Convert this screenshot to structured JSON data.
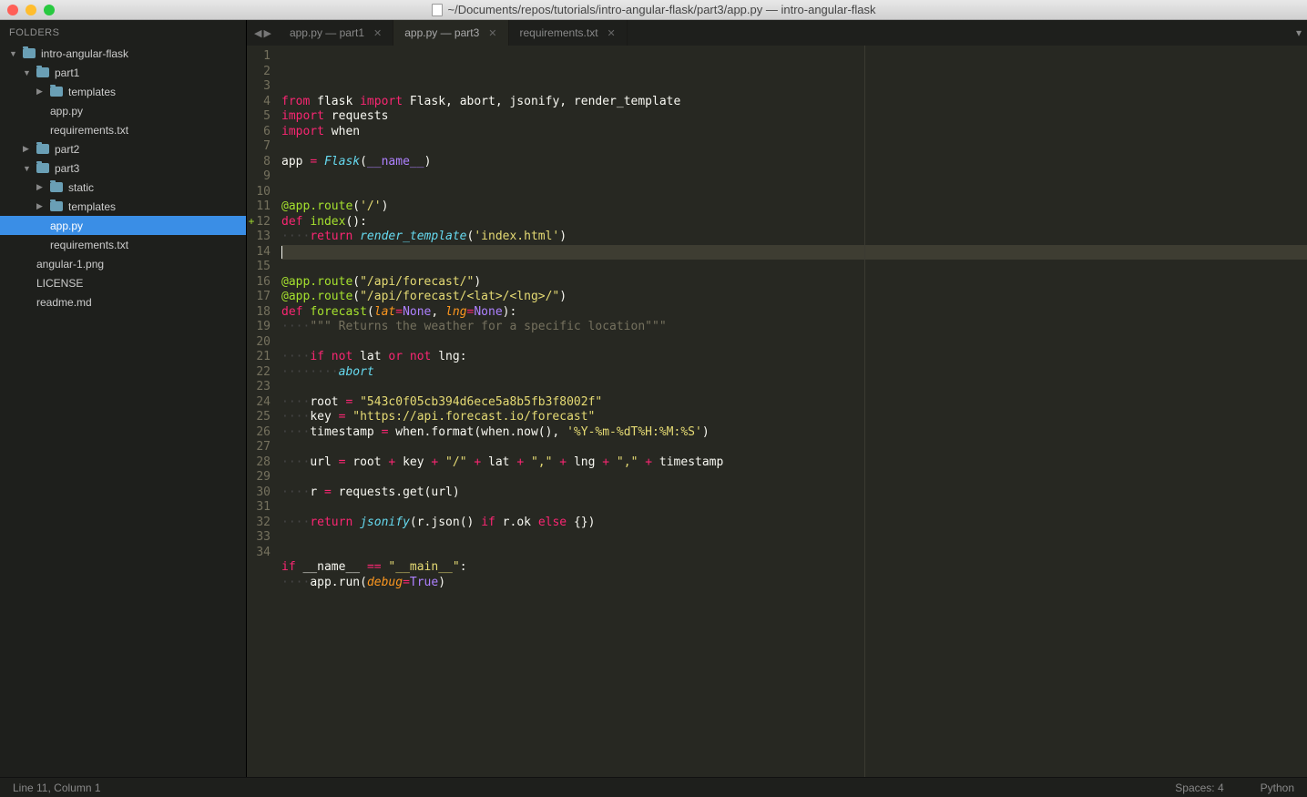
{
  "window": {
    "title": "~/Documents/repos/tutorials/intro-angular-flask/part3/app.py — intro-angular-flask"
  },
  "sidebar": {
    "header": "FOLDERS",
    "tree": [
      {
        "label": "intro-angular-flask",
        "type": "folder",
        "depth": 0,
        "expanded": true
      },
      {
        "label": "part1",
        "type": "folder",
        "depth": 1,
        "expanded": true
      },
      {
        "label": "templates",
        "type": "folder",
        "depth": 2,
        "expanded": false
      },
      {
        "label": "app.py",
        "type": "file",
        "depth": 2
      },
      {
        "label": "requirements.txt",
        "type": "file",
        "depth": 2
      },
      {
        "label": "part2",
        "type": "folder",
        "depth": 1,
        "expanded": false
      },
      {
        "label": "part3",
        "type": "folder",
        "depth": 1,
        "expanded": true
      },
      {
        "label": "static",
        "type": "folder",
        "depth": 2,
        "expanded": false
      },
      {
        "label": "templates",
        "type": "folder",
        "depth": 2,
        "expanded": false
      },
      {
        "label": "app.py",
        "type": "file",
        "depth": 2,
        "selected": true
      },
      {
        "label": "requirements.txt",
        "type": "file",
        "depth": 2
      },
      {
        "label": "angular-1.png",
        "type": "file",
        "depth": 1
      },
      {
        "label": "LICENSE",
        "type": "file",
        "depth": 1
      },
      {
        "label": "readme.md",
        "type": "file",
        "depth": 1
      }
    ]
  },
  "tabs": [
    {
      "label": "app.py — part1",
      "active": false
    },
    {
      "label": "app.py — part3",
      "active": true
    },
    {
      "label": "requirements.txt",
      "active": false
    }
  ],
  "editor": {
    "ruler_col": 80,
    "gutter_plus_line": 12,
    "current_line_index": 10,
    "lines": [
      [
        {
          "t": "from",
          "c": "kw"
        },
        {
          "t": " "
        },
        {
          "t": "flask",
          "c": ""
        },
        {
          "t": " "
        },
        {
          "t": "import",
          "c": "kw"
        },
        {
          "t": " "
        },
        {
          "t": "Flask, abort, jsonify, render_template",
          "c": ""
        }
      ],
      [
        {
          "t": "import",
          "c": "kw"
        },
        {
          "t": " "
        },
        {
          "t": "requests",
          "c": ""
        }
      ],
      [
        {
          "t": "import",
          "c": "kw"
        },
        {
          "t": " "
        },
        {
          "t": "when",
          "c": ""
        }
      ],
      [],
      [
        {
          "t": "app ",
          "c": ""
        },
        {
          "t": "=",
          "c": "op"
        },
        {
          "t": " ",
          "c": ""
        },
        {
          "t": "Flask",
          "c": "cls"
        },
        {
          "t": "(",
          "c": ""
        },
        {
          "t": "__name__",
          "c": "const"
        },
        {
          "t": ")",
          "c": ""
        }
      ],
      [],
      [],
      [
        {
          "t": "@app.route",
          "c": "decorator"
        },
        {
          "t": "(",
          "c": ""
        },
        {
          "t": "'/'",
          "c": "str"
        },
        {
          "t": ")",
          "c": ""
        }
      ],
      [
        {
          "t": "def",
          "c": "kw"
        },
        {
          "t": " "
        },
        {
          "t": "index",
          "c": "fn"
        },
        {
          "t": "():",
          "c": ""
        }
      ],
      [
        {
          "t": "····",
          "c": "dots"
        },
        {
          "t": "return",
          "c": "kw"
        },
        {
          "t": " ",
          "c": ""
        },
        {
          "t": "render_template",
          "c": "cls"
        },
        {
          "t": "(",
          "c": ""
        },
        {
          "t": "'index.html'",
          "c": "str"
        },
        {
          "t": ")",
          "c": ""
        }
      ],
      [
        {
          "t": "",
          "c": "",
          "cursor": true
        }
      ],
      [],
      [
        {
          "t": "@app.route",
          "c": "decorator"
        },
        {
          "t": "(",
          "c": ""
        },
        {
          "t": "\"/api/forecast/\"",
          "c": "str"
        },
        {
          "t": ")",
          "c": ""
        }
      ],
      [
        {
          "t": "@app.route",
          "c": "decorator"
        },
        {
          "t": "(",
          "c": ""
        },
        {
          "t": "\"/api/forecast/<lat>/<lng>/\"",
          "c": "str"
        },
        {
          "t": ")",
          "c": ""
        }
      ],
      [
        {
          "t": "def",
          "c": "kw"
        },
        {
          "t": " "
        },
        {
          "t": "forecast",
          "c": "fn"
        },
        {
          "t": "(",
          "c": ""
        },
        {
          "t": "lat",
          "c": "param"
        },
        {
          "t": "=",
          "c": "op"
        },
        {
          "t": "None",
          "c": "const"
        },
        {
          "t": ", ",
          "c": ""
        },
        {
          "t": "lng",
          "c": "param"
        },
        {
          "t": "=",
          "c": "op"
        },
        {
          "t": "None",
          "c": "const"
        },
        {
          "t": "):",
          "c": ""
        }
      ],
      [
        {
          "t": "····",
          "c": "dots"
        },
        {
          "t": "\"\"\" Returns the weather for a specific location\"\"\"",
          "c": "comment"
        }
      ],
      [],
      [
        {
          "t": "····",
          "c": "dots"
        },
        {
          "t": "if",
          "c": "kw"
        },
        {
          "t": " "
        },
        {
          "t": "not",
          "c": "kw"
        },
        {
          "t": " lat "
        },
        {
          "t": "or",
          "c": "kw"
        },
        {
          "t": " "
        },
        {
          "t": "not",
          "c": "kw"
        },
        {
          "t": " lng:",
          "c": ""
        }
      ],
      [
        {
          "t": "········",
          "c": "dots"
        },
        {
          "t": "abort",
          "c": "cls"
        }
      ],
      [],
      [
        {
          "t": "····",
          "c": "dots"
        },
        {
          "t": "root ",
          "c": ""
        },
        {
          "t": "=",
          "c": "op"
        },
        {
          "t": " ",
          "c": ""
        },
        {
          "t": "\"543c0f05cb394d6ece5a8b5fb3f8002f\"",
          "c": "str"
        }
      ],
      [
        {
          "t": "····",
          "c": "dots"
        },
        {
          "t": "key ",
          "c": ""
        },
        {
          "t": "=",
          "c": "op"
        },
        {
          "t": " ",
          "c": ""
        },
        {
          "t": "\"https://api.forecast.io/forecast\"",
          "c": "str"
        }
      ],
      [
        {
          "t": "····",
          "c": "dots"
        },
        {
          "t": "timestamp ",
          "c": ""
        },
        {
          "t": "=",
          "c": "op"
        },
        {
          "t": " when.format(when.now(), ",
          "c": ""
        },
        {
          "t": "'%Y-%m-%dT%H:%M:%S'",
          "c": "str"
        },
        {
          "t": ")",
          "c": ""
        }
      ],
      [],
      [
        {
          "t": "····",
          "c": "dots"
        },
        {
          "t": "url ",
          "c": ""
        },
        {
          "t": "=",
          "c": "op"
        },
        {
          "t": " root ",
          "c": ""
        },
        {
          "t": "+",
          "c": "op"
        },
        {
          "t": " key ",
          "c": ""
        },
        {
          "t": "+",
          "c": "op"
        },
        {
          "t": " ",
          "c": ""
        },
        {
          "t": "\"/\"",
          "c": "str"
        },
        {
          "t": " ",
          "c": ""
        },
        {
          "t": "+",
          "c": "op"
        },
        {
          "t": " lat ",
          "c": ""
        },
        {
          "t": "+",
          "c": "op"
        },
        {
          "t": " ",
          "c": ""
        },
        {
          "t": "\",\"",
          "c": "str"
        },
        {
          "t": " ",
          "c": ""
        },
        {
          "t": "+",
          "c": "op"
        },
        {
          "t": " lng ",
          "c": ""
        },
        {
          "t": "+",
          "c": "op"
        },
        {
          "t": " ",
          "c": ""
        },
        {
          "t": "\",\"",
          "c": "str"
        },
        {
          "t": " ",
          "c": ""
        },
        {
          "t": "+",
          "c": "op"
        },
        {
          "t": " timestamp",
          "c": ""
        }
      ],
      [],
      [
        {
          "t": "····",
          "c": "dots"
        },
        {
          "t": "r ",
          "c": ""
        },
        {
          "t": "=",
          "c": "op"
        },
        {
          "t": " requests.get(url)",
          "c": ""
        }
      ],
      [],
      [
        {
          "t": "····",
          "c": "dots"
        },
        {
          "t": "return",
          "c": "kw"
        },
        {
          "t": " ",
          "c": ""
        },
        {
          "t": "jsonify",
          "c": "cls"
        },
        {
          "t": "(r.json() ",
          "c": ""
        },
        {
          "t": "if",
          "c": "kw"
        },
        {
          "t": " r.ok ",
          "c": ""
        },
        {
          "t": "else",
          "c": "kw"
        },
        {
          "t": " {})",
          "c": ""
        }
      ],
      [],
      [],
      [
        {
          "t": "if",
          "c": "kw"
        },
        {
          "t": " __name__ ",
          "c": ""
        },
        {
          "t": "==",
          "c": "op"
        },
        {
          "t": " ",
          "c": ""
        },
        {
          "t": "\"__main__\"",
          "c": "str"
        },
        {
          "t": ":",
          "c": ""
        }
      ],
      [
        {
          "t": "····",
          "c": "dots"
        },
        {
          "t": "app.run(",
          "c": ""
        },
        {
          "t": "debug",
          "c": "param"
        },
        {
          "t": "=",
          "c": "op"
        },
        {
          "t": "True",
          "c": "const"
        },
        {
          "t": ")",
          "c": ""
        }
      ],
      []
    ]
  },
  "statusbar": {
    "position": "Line 11, Column 1",
    "spaces": "Spaces: 4",
    "lang": "Python"
  }
}
